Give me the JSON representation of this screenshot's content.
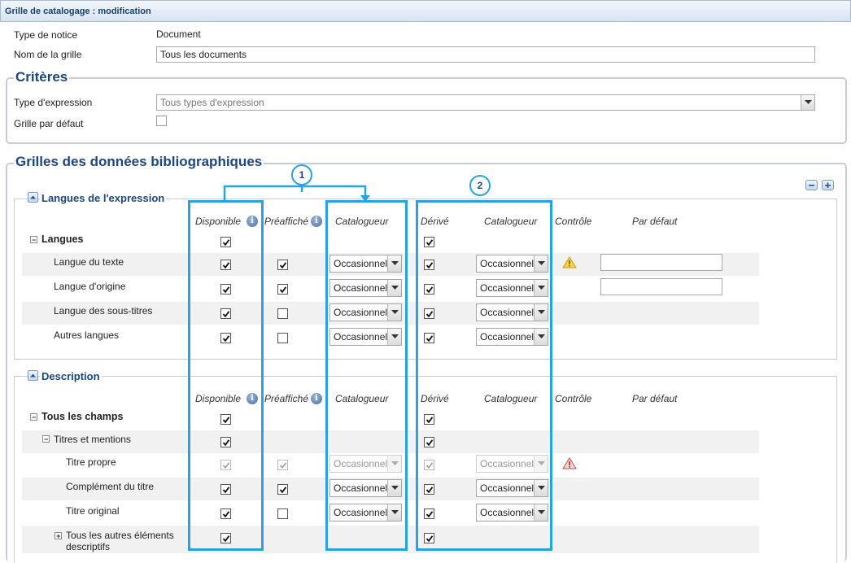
{
  "window": {
    "title": "Grille de catalogage : modification"
  },
  "form": {
    "type_notice_label": "Type de notice",
    "type_notice_value": "Document",
    "nom_grille_label": "Nom de la grille",
    "nom_grille_value": "Tous les documents"
  },
  "criteres": {
    "legend": "Critères",
    "type_expression_label": "Type d'expression",
    "type_expression_value": "Tous types d'expression",
    "grille_defaut_label": "Grille par défaut",
    "grille_defaut_checked": false
  },
  "grilles": {
    "legend": "Grilles des données bibliographiques",
    "annotation_1": "1",
    "annotation_2": "2"
  },
  "headers": {
    "disponible": "Disponible",
    "preaffiche": "Préaffiché",
    "catalogueur": "Catalogueur",
    "derive": "Dérivé",
    "catalogueur2": "Catalogueur",
    "controle": "Contrôle",
    "par_defaut": "Par défaut"
  },
  "section_langues": {
    "title": "Langues de l'expression",
    "group_label": "Langues",
    "rows": [
      {
        "label": "Langue du texte",
        "disponible": true,
        "preaffiche": true,
        "catalogueur": "Occasionnel",
        "derive": true,
        "catalogueur2": "Occasionnel",
        "warning": true,
        "default_field": ""
      },
      {
        "label": "Langue d'origine",
        "disponible": true,
        "preaffiche": true,
        "catalogueur": "Occasionnel",
        "derive": true,
        "catalogueur2": "Occasionnel",
        "warning": false,
        "default_field": ""
      },
      {
        "label": "Langue des sous-titres",
        "disponible": true,
        "preaffiche": false,
        "catalogueur": "Occasionnel",
        "derive": true,
        "catalogueur2": "Occasionnel"
      },
      {
        "label": "Autres langues",
        "disponible": true,
        "preaffiche": false,
        "catalogueur": "Occasionnel",
        "derive": true,
        "catalogueur2": "Occasionnel"
      }
    ]
  },
  "section_description": {
    "title": "Description",
    "group_label": "Tous les champs",
    "subgroup_label": "Titres et mentions",
    "rows": [
      {
        "label": "Titre propre",
        "disponible": true,
        "preaffiche": true,
        "catalogueur": "Occasionnel",
        "derive": true,
        "catalogueur2": "Occasionnel",
        "disabled": true,
        "error": true
      },
      {
        "label": "Complément du titre",
        "disponible": true,
        "preaffiche": true,
        "catalogueur": "Occasionnel",
        "derive": true,
        "catalogueur2": "Occasionnel"
      },
      {
        "label": "Titre original",
        "disponible": true,
        "preaffiche": false,
        "catalogueur": "Occasionnel",
        "derive": true,
        "catalogueur2": "Occasionnel"
      }
    ],
    "other_label_1": "Tous les autres éléments",
    "other_label_2": "descriptifs"
  },
  "colors": {
    "accent": "#29a3e0",
    "title": "#1d4680",
    "border": "#c7ccd4"
  }
}
